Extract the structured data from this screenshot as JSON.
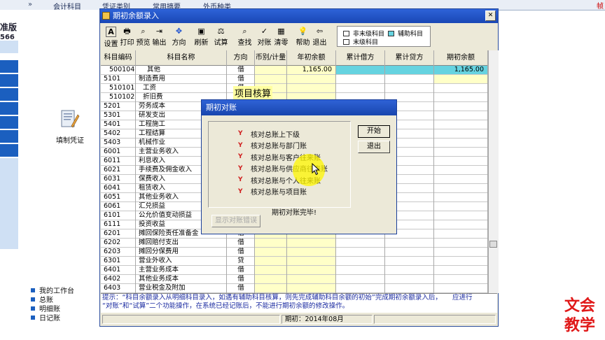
{
  "background_app": {
    "menu": [
      "会计科目",
      "凭证类别",
      "常用摘要",
      "外币种类"
    ],
    "edition_label": "准版",
    "edition_number": "566",
    "voucher_entry_label": "填制凭证",
    "left_links": [
      "我的工作台",
      "总账",
      "明细账",
      "日记账"
    ],
    "right_edge_text": "帧"
  },
  "watermark": {
    "line1": "文会",
    "line2": "教学"
  },
  "main_window": {
    "title": "期初余额录入",
    "toolbar": [
      {
        "id": "setup",
        "label": "设置",
        "icon": "A"
      },
      {
        "id": "print",
        "label": "打印",
        "icon": "print"
      },
      {
        "id": "preview",
        "label": "预览",
        "icon": "preview"
      },
      {
        "id": "export",
        "label": "输出",
        "icon": "export"
      },
      {
        "id": "direction",
        "label": "方向",
        "icon": "direction"
      },
      {
        "id": "refresh",
        "label": "刷新",
        "icon": "refresh"
      },
      {
        "id": "trial",
        "label": "试算",
        "icon": "scale"
      },
      {
        "id": "find",
        "label": "查找",
        "icon": "find"
      },
      {
        "id": "reconcile",
        "label": "对账",
        "icon": "check"
      },
      {
        "id": "clear",
        "label": "清零",
        "icon": "clear"
      },
      {
        "id": "help",
        "label": "帮助",
        "icon": "help"
      },
      {
        "id": "exit",
        "label": "退出",
        "icon": "exit"
      }
    ],
    "legend": [
      {
        "label": "非末级科目",
        "color": "#ffffff"
      },
      {
        "label": "辅助科目",
        "color": "#66d3e0"
      },
      {
        "label": "末级科目",
        "color": "#ffffff"
      }
    ],
    "columns": [
      "科目编码",
      "科目名称",
      "方向",
      "币别/计量",
      "年初余额",
      "累计借方",
      "累计贷方",
      "期初余额"
    ],
    "rows": [
      {
        "code": "500104",
        "name": "其他",
        "dir": "借",
        "opening": "1,165.00",
        "ending": "1,165.00",
        "aux": true,
        "indent": 2
      },
      {
        "code": "5101",
        "name": "制造费用",
        "dir": "借",
        "indent": 0
      },
      {
        "code": "510101",
        "name": "工资",
        "dir": "借",
        "indent": 1
      },
      {
        "code": "510102",
        "name": "折旧费",
        "dir": "借",
        "indent": 1
      },
      {
        "code": "5201",
        "name": "劳务成本",
        "dir": "借",
        "indent": 0
      },
      {
        "code": "5301",
        "name": "研发支出",
        "dir": "借",
        "indent": 0
      },
      {
        "code": "5401",
        "name": "工程施工",
        "dir": "借",
        "indent": 0
      },
      {
        "code": "5402",
        "name": "工程结算",
        "dir": "借",
        "indent": 0
      },
      {
        "code": "5403",
        "name": "机械作业",
        "dir": "借",
        "indent": 0
      },
      {
        "code": "6001",
        "name": "主营业务收入",
        "dir": "贷",
        "indent": 0
      },
      {
        "code": "6011",
        "name": "利息收入",
        "dir": "贷",
        "indent": 0
      },
      {
        "code": "6021",
        "name": "手续费及佣金收入",
        "dir": "贷",
        "indent": 0
      },
      {
        "code": "6031",
        "name": "保费收入",
        "dir": "贷",
        "indent": 0
      },
      {
        "code": "6041",
        "name": "租赁收入",
        "dir": "贷",
        "indent": 0
      },
      {
        "code": "6051",
        "name": "其他业务收入",
        "dir": "贷",
        "indent": 0
      },
      {
        "code": "6061",
        "name": "汇兑损益",
        "dir": "贷",
        "indent": 0
      },
      {
        "code": "6101",
        "name": "公允价值变动损益",
        "dir": "贷",
        "indent": 0
      },
      {
        "code": "6111",
        "name": "投资收益",
        "dir": "贷",
        "indent": 0
      },
      {
        "code": "6201",
        "name": "摊回保险责任准备金",
        "dir": "借",
        "indent": 0
      },
      {
        "code": "6202",
        "name": "摊回赔付支出",
        "dir": "借",
        "indent": 0
      },
      {
        "code": "6203",
        "name": "摊回分保费用",
        "dir": "借",
        "indent": 0
      },
      {
        "code": "6301",
        "name": "营业外收入",
        "dir": "贷",
        "indent": 0
      },
      {
        "code": "6401",
        "name": "主营业务成本",
        "dir": "借",
        "indent": 0
      },
      {
        "code": "6402",
        "name": "其他业务成本",
        "dir": "借",
        "indent": 0
      },
      {
        "code": "6403",
        "name": "营业税金及附加",
        "dir": "借",
        "indent": 0
      }
    ],
    "tooltip": "项目核算",
    "hint_line1": "提示：“科目余额录入从明细科目录入，如遇有辅助科目核算，则先完成辅助科目余额的初始”完成期初余额录入后，",
    "hint_line1_right": "应进行",
    "hint_line2": "“对账”和“试算”二个功能操作，在系统已经记账后，不能进行期初余额的修改操作。",
    "period": "期初：2014年08月"
  },
  "recon_dialog": {
    "title": "期初对账",
    "checks": [
      "核对总账上下级",
      "核对总账与部门账",
      "核对总账与客户往来账",
      "核对总账与供应商往来账",
      "核对总账与个人往来账",
      "核对总账与项目账"
    ],
    "check_mark": "Y",
    "start_button": "开始",
    "exit_button": "退出",
    "done_message": "期初对账完毕!",
    "show_errors_button": "显示对账错误"
  }
}
